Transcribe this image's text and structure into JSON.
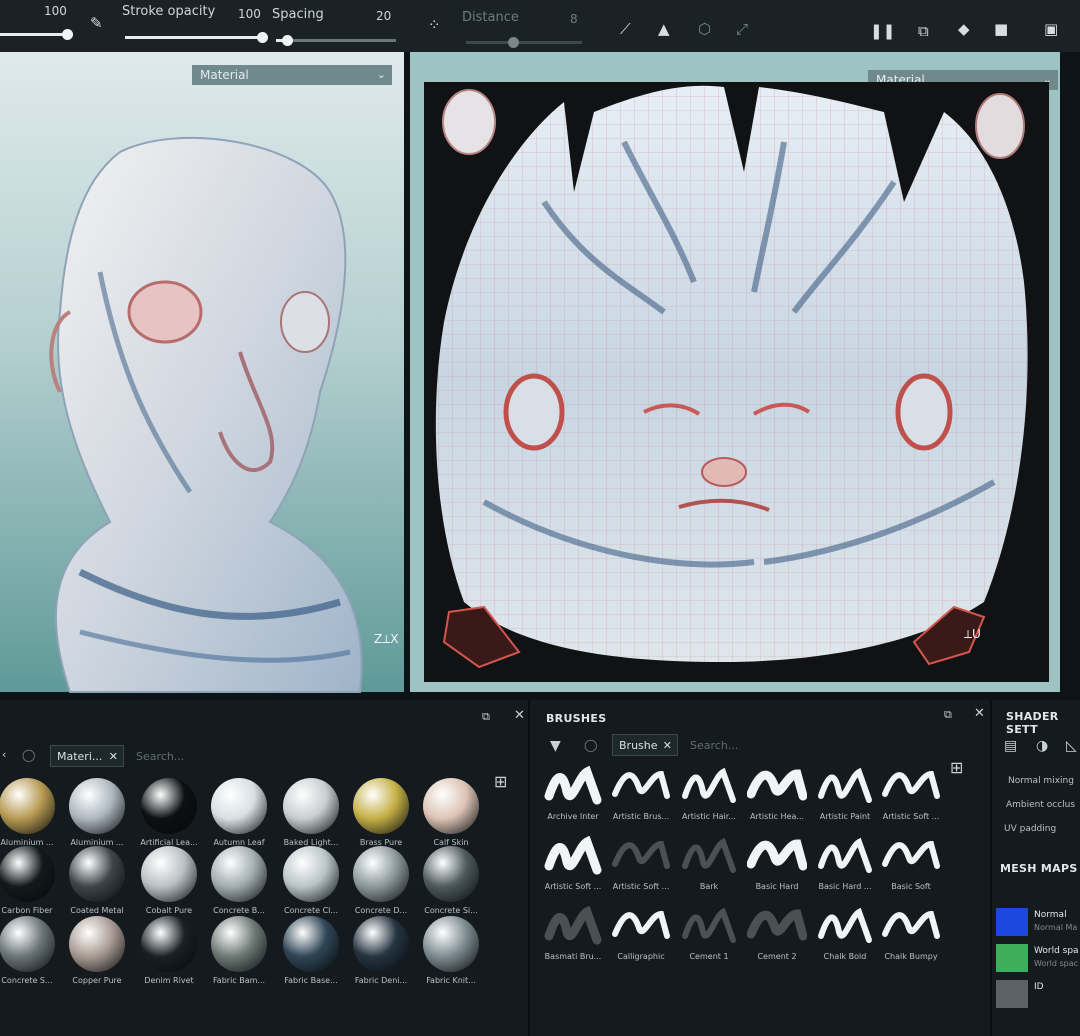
{
  "toolbar": {
    "size_value": "100",
    "stroke_opacity_label": "Stroke opacity",
    "stroke_opacity_value": "100",
    "spacing_label": "Spacing",
    "spacing_value": "20",
    "distance_label": "Distance",
    "distance_value": "8"
  },
  "viewport_left": {
    "dropdown": "Material"
  },
  "viewport_right": {
    "dropdown": "Material"
  },
  "shelf": {
    "tab_label": "Materi...",
    "search_placeholder": "Search...",
    "materials": [
      {
        "name": "Aluminium ...",
        "color": "#b79a52"
      },
      {
        "name": "Aluminium ...",
        "color": "#aeb7bf"
      },
      {
        "name": "Artificial Lea...",
        "color": "#0d1012"
      },
      {
        "name": "Autumn Leaf",
        "color": "#d8dfe3"
      },
      {
        "name": "Baked Light...",
        "color": "#c8cdcf"
      },
      {
        "name": "Brass Pure",
        "color": "#c5b046"
      },
      {
        "name": "Calf Skin",
        "color": "#dcc3b4"
      },
      {
        "name": "Carbon Fiber",
        "color": "#14191c"
      },
      {
        "name": "Coated Metal",
        "color": "#3d4549"
      },
      {
        "name": "Cobalt Pure",
        "color": "#b9c0c4"
      },
      {
        "name": "Concrete B...",
        "color": "#a3adb0"
      },
      {
        "name": "Concrete Cl...",
        "color": "#b9c4c8"
      },
      {
        "name": "Concrete D...",
        "color": "#8d999c"
      },
      {
        "name": "Concrete Si...",
        "color": "#4e5a5e"
      },
      {
        "name": "Concrete S...",
        "color": "#6b7477"
      },
      {
        "name": "Copper Pure",
        "color": "#a89b93"
      },
      {
        "name": "Denim Rivet",
        "color": "#1a2024"
      },
      {
        "name": "Fabric Bam...",
        "color": "#6e7a76"
      },
      {
        "name": "Fabric Base...",
        "color": "#2f4656"
      },
      {
        "name": "Fabric Deni...",
        "color": "#253440"
      },
      {
        "name": "Fabric Knit...",
        "color": "#7d8b90"
      }
    ]
  },
  "brushes": {
    "title": "BRUSHES",
    "tab_label": "Brushe",
    "search_placeholder": "Search...",
    "items": [
      {
        "name": "Archive Inter"
      },
      {
        "name": "Artistic Brus..."
      },
      {
        "name": "Artistic Hair..."
      },
      {
        "name": "Artistic Hea..."
      },
      {
        "name": "Artistic Paint"
      },
      {
        "name": "Artistic Soft ..."
      },
      {
        "name": "Artistic Soft ..."
      },
      {
        "name": "Artistic Soft ..."
      },
      {
        "name": "Bark"
      },
      {
        "name": "Basic Hard"
      },
      {
        "name": "Basic Hard ..."
      },
      {
        "name": "Basic Soft"
      },
      {
        "name": "Basmati Bru..."
      },
      {
        "name": "Calligraphic"
      },
      {
        "name": "Cement 1"
      },
      {
        "name": "Cement 2"
      },
      {
        "name": "Chalk Bold"
      },
      {
        "name": "Chalk Bumpy"
      }
    ]
  },
  "shader": {
    "title": "SHADER SETT",
    "rows": [
      "Normal mixing",
      "Ambient occlus",
      "UV padding"
    ],
    "mesh_maps_title": "MESH MAPS",
    "maps": [
      {
        "name": "Normal",
        "sub": "Normal Ma",
        "color": "#1d48e0"
      },
      {
        "name": "World spa",
        "sub": "World spac",
        "color": "#3fae5a"
      },
      {
        "name": "ID",
        "sub": "",
        "color": "#5a6266"
      }
    ]
  }
}
